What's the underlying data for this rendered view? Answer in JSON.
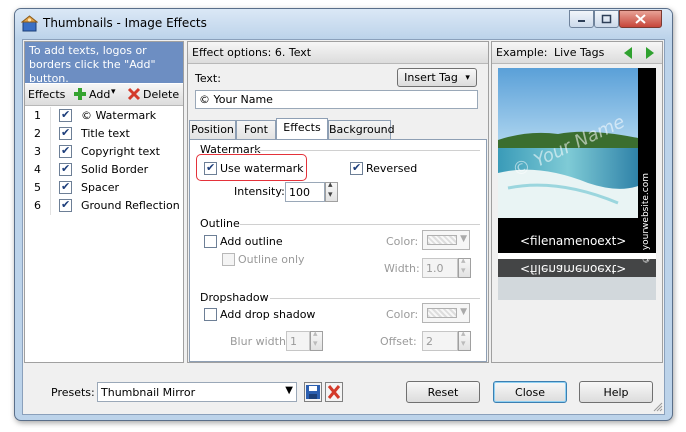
{
  "window": {
    "title": "Thumbnails - Image Effects"
  },
  "left": {
    "hint": "To add texts, logos or borders click the \"Add\" button.",
    "toolbar": {
      "effects_label": "Effects",
      "add_label": "Add",
      "delete_label": "Delete"
    },
    "items": [
      {
        "num": "1",
        "label": "© Watermark",
        "checked": true
      },
      {
        "num": "2",
        "label": "Title text",
        "checked": true
      },
      {
        "num": "3",
        "label": "Copyright text",
        "checked": true
      },
      {
        "num": "4",
        "label": "Solid Border",
        "checked": true
      },
      {
        "num": "5",
        "label": "Spacer",
        "checked": true
      },
      {
        "num": "6",
        "label": "Ground Reflection",
        "checked": true
      }
    ]
  },
  "middle": {
    "header": "Effect options: 6. Text",
    "text_label": "Text:",
    "insert_tag": "Insert Tag",
    "text_value": "© Your Name",
    "tabs": [
      "Position",
      "Font",
      "Effects",
      "Background"
    ],
    "active_tab": "Effects",
    "watermark": {
      "title": "Watermark",
      "use_label": "Use watermark",
      "reversed_label": "Reversed",
      "intensity_label": "Intensity:",
      "intensity_value": "100"
    },
    "outline": {
      "title": "Outline",
      "add_label": "Add outline",
      "only_label": "Outline only",
      "color_label": "Color:",
      "width_label": "Width:",
      "width_value": "1.0"
    },
    "dropshadow": {
      "title": "Dropshadow",
      "add_label": "Add drop shadow",
      "color_label": "Color:",
      "blur_label": "Blur width:",
      "blur_value": "1",
      "offset_label": "Offset:",
      "offset_value": "2"
    }
  },
  "right": {
    "example_label": "Example:",
    "live_tags": "Live Tags",
    "side_text": "© yourwebsite.com",
    "watermark_text": "© Your Name",
    "filename_text": "<filenamenoext>"
  },
  "bottom": {
    "presets_label": "Presets:",
    "preset_value": "Thumbnail Mirror",
    "reset": "Reset",
    "close": "Close",
    "help": "Help"
  }
}
